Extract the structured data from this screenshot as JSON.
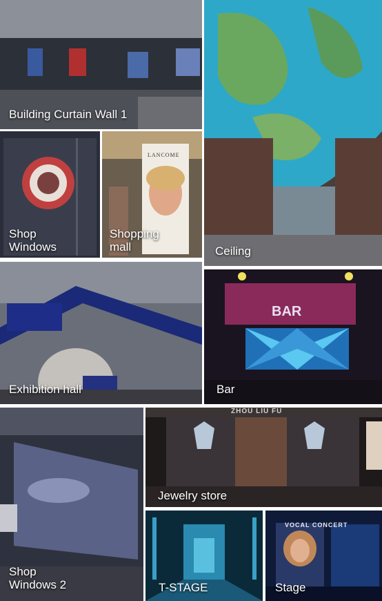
{
  "tiles": {
    "building_curtain_wall": {
      "label": "Building Curtain Wall 1"
    },
    "shop_windows": {
      "label": "Shop\nWindows"
    },
    "shopping_mall": {
      "label": "Shopping\nmall",
      "sign_text": "LANCOME"
    },
    "ceiling": {
      "label": "Ceiling"
    },
    "exhibition_hall": {
      "label": "Exhibition hall"
    },
    "bar": {
      "label": "Bar",
      "sign_text": "BAR"
    },
    "shop_windows_2": {
      "label": "Shop\nWindows 2"
    },
    "jewelry_store": {
      "label": "Jewelry store",
      "sign_text": "ZHOU LIU FU"
    },
    "t_stage": {
      "label": "T-STAGE"
    },
    "stage": {
      "label": "Stage",
      "sign_text": "VOCAL CONCERT"
    }
  }
}
